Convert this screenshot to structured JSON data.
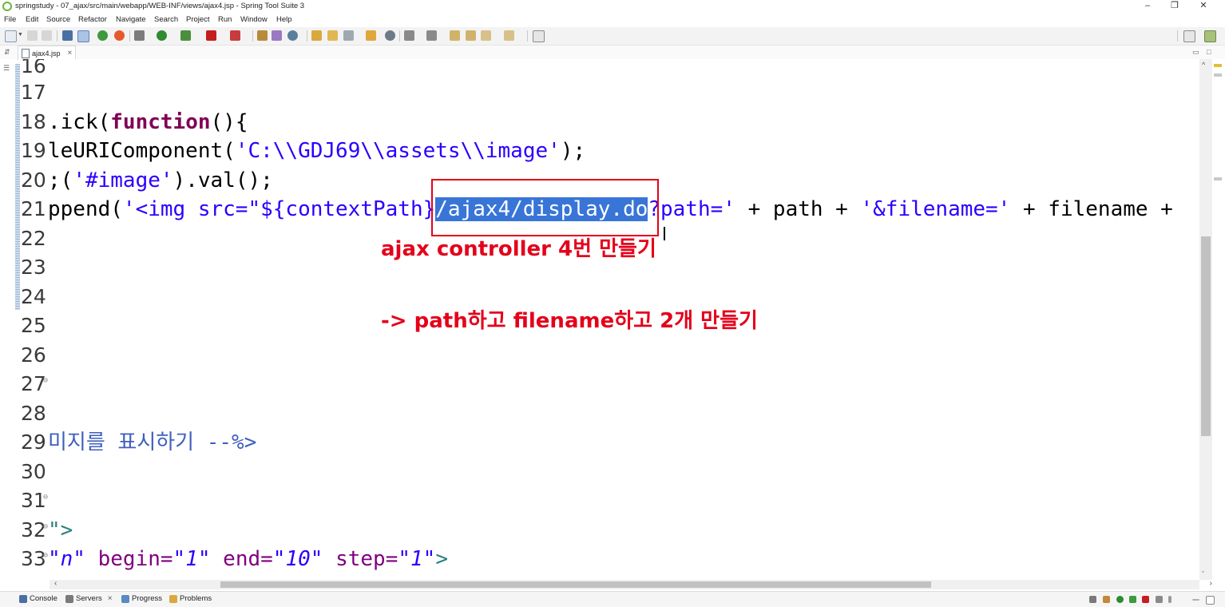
{
  "window": {
    "title": "springstudy - 07_ajax/src/main/webapp/WEB-INF/views/ajax4.jsp - Spring Tool Suite 3",
    "minimize": "–",
    "restore": "❐",
    "close": "✕"
  },
  "menu": [
    "File",
    "Edit",
    "Source",
    "Refactor",
    "Navigate",
    "Search",
    "Project",
    "Run",
    "Window",
    "Help"
  ],
  "editor_tab": {
    "label": "ajax4.jsp",
    "close": "×"
  },
  "code_lines": [
    {
      "n": "16",
      "text": ""
    },
    {
      "n": "17",
      "text": ""
    },
    {
      "n": "18",
      "pre": ".ick(",
      "kw": "function",
      "post": "(){"
    },
    {
      "n": "19",
      "pre": "leURIComponent(",
      "str": "'C:\\\\GDJ69\\\\assets\\\\image'",
      "post": ");"
    },
    {
      "n": "20",
      "pre": ";(",
      "str": "'#image'",
      "post": ").val();"
    },
    {
      "n": "21",
      "pre": "ppend(",
      "str1": "'<img src=\"${contextPath}",
      "sel": "/ajax4/display.do",
      "str2": "?path='",
      "post": " + path + ",
      "str3": "'&filename='",
      "post2": " + filename +"
    },
    {
      "n": "22",
      "text": ""
    },
    {
      "n": "23",
      "text": ""
    },
    {
      "n": "24",
      "text": ""
    },
    {
      "n": "25",
      "text": ""
    },
    {
      "n": "26",
      "text": ""
    },
    {
      "n": "27",
      "text": ""
    },
    {
      "n": "28",
      "text": ""
    },
    {
      "n": "29",
      "comment": "미지를 표시하기 --%>"
    },
    {
      "n": "30",
      "text": ""
    },
    {
      "n": "31",
      "text": ""
    },
    {
      "n": "32",
      "tail": "\">"
    },
    {
      "n": "33",
      "it1": "\"n\"",
      "a1": " begin=",
      "it2": "\"1\"",
      "a2": " end=",
      "it3": "\"10\"",
      "a3": " step=",
      "it4": "\"1\"",
      "t": ">"
    }
  ],
  "annotations": {
    "line1": "ajax controller 4번 만들기",
    "line2": "-> path하고 filename하고 2개 만들기"
  },
  "bottom_tabs": [
    {
      "label": "Console"
    },
    {
      "label": "Servers",
      "close": "×"
    },
    {
      "label": "Progress"
    },
    {
      "label": "Problems"
    }
  ],
  "search_icon": "search-icon",
  "colors": {
    "keyword": "#7f0055",
    "string": "#2a00ff",
    "selection": "#3875d7",
    "annotation": "#e4001a"
  }
}
